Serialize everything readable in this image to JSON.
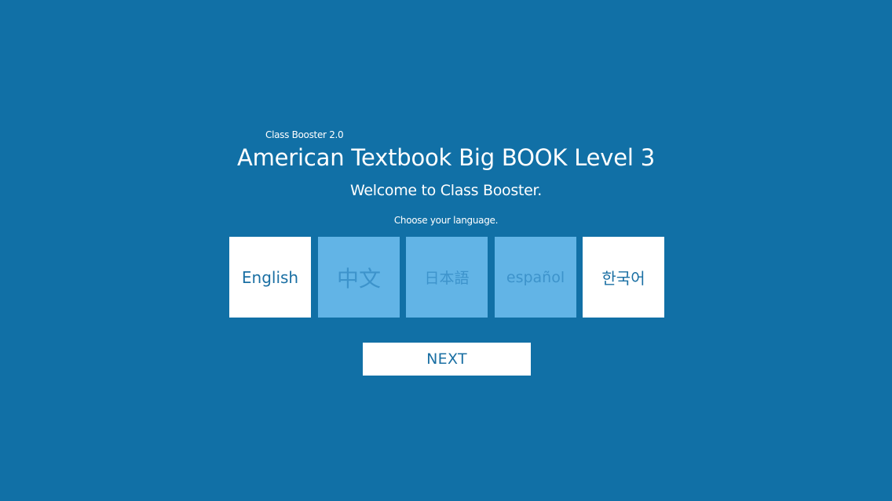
{
  "header": {
    "app_version": "Class Booster 2.0",
    "product_title": "American Textbook Big BOOK Level 3",
    "welcome": "Welcome to Class Booster.",
    "prompt": "Choose your language."
  },
  "languages": [
    {
      "label": "English",
      "state": "active"
    },
    {
      "label": "中文",
      "state": "inactive"
    },
    {
      "label": "日本語",
      "state": "inactive"
    },
    {
      "label": "español",
      "state": "inactive"
    },
    {
      "label": "한국어",
      "state": "active"
    }
  ],
  "actions": {
    "next_label": "NEXT"
  },
  "colors": {
    "background": "#1170a6",
    "tile_active": "#ffffff",
    "tile_inactive": "#62b4e6",
    "text_accent": "#1a6fa3"
  }
}
